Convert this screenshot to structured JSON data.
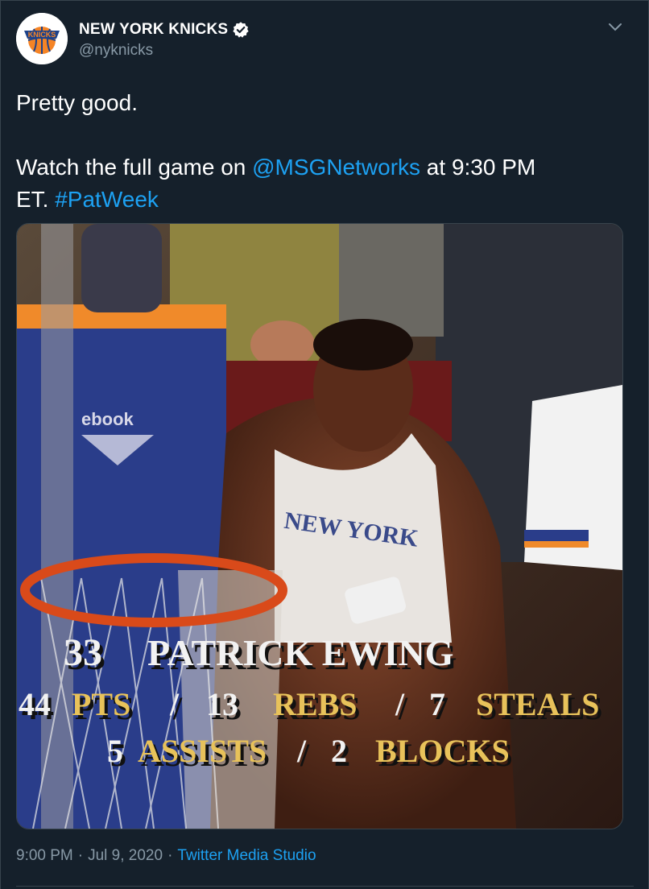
{
  "author": {
    "display_name": "NEW YORK KNICKS",
    "handle": "@nyknicks",
    "avatar_text": "KNICKS"
  },
  "tweet": {
    "line1": "Pretty good.",
    "line2_prefix": "Watch the full game on ",
    "mention": "@MSGNetworks",
    "line2_mid": " at 9:30 PM",
    "line3_prefix": "ET. ",
    "hashtag": "#PatWeek"
  },
  "media": {
    "graphic": {
      "line1_number": "33",
      "line1_name": "PATRICK EWING",
      "line2": [
        "44",
        "PTS",
        "/",
        "13",
        "REBS",
        "/",
        "7",
        "STEALS"
      ],
      "line3": [
        "5",
        "ASSISTS",
        "/",
        "2",
        "BLOCKS"
      ]
    },
    "jersey_text": "NEW YORK",
    "jacket_text": "ebook"
  },
  "footer": {
    "time": "9:00 PM",
    "sep1": "·",
    "date": "Jul 9, 2020",
    "sep2": "·",
    "source": "Twitter Media Studio"
  },
  "colors": {
    "background": "#15202b",
    "link": "#1da1f2",
    "secondary_text": "#8899a6",
    "border": "#38444d",
    "graphic_white": "#f2f2f2",
    "graphic_gold": "#e8c25a"
  },
  "icons": {
    "verified": "verified-badge-icon",
    "caret": "chevron-down-icon"
  }
}
